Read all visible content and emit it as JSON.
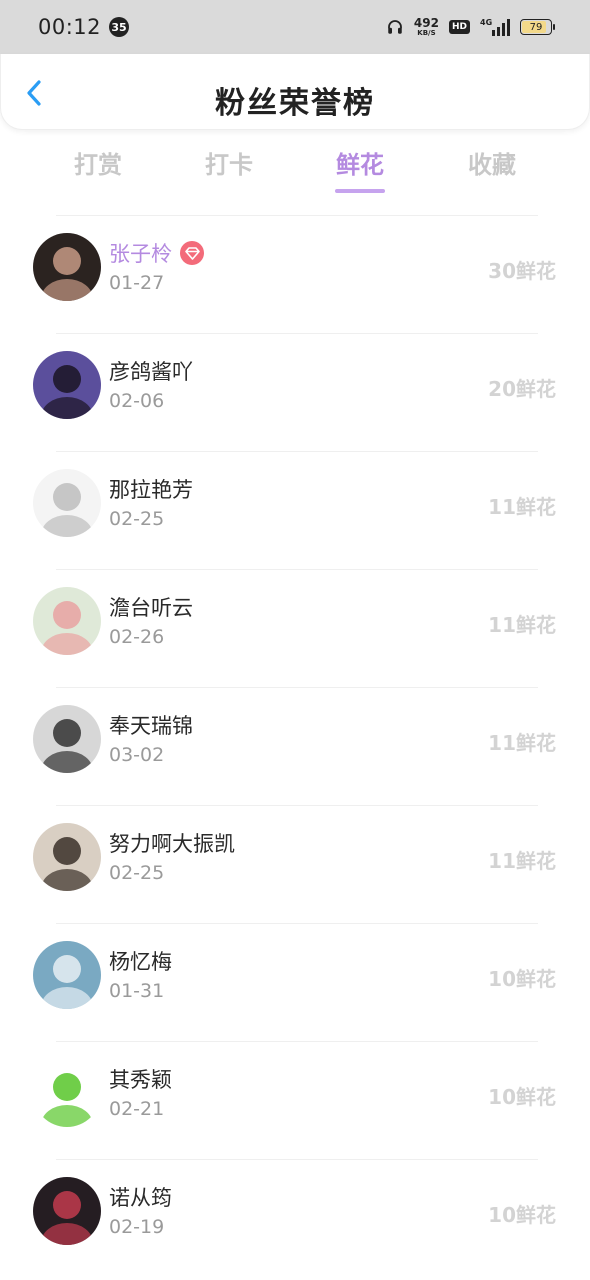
{
  "status_bar": {
    "time": "00:12",
    "notification_count": "35",
    "net_speed_value": "492",
    "net_speed_unit": "KB/S",
    "hd_label": "HD",
    "network_label": "4G",
    "battery_level": "79"
  },
  "header": {
    "title": "粉丝荣誉榜",
    "back_icon": "chevron-left-icon"
  },
  "tabs": [
    {
      "label": "打赏",
      "active": false
    },
    {
      "label": "打卡",
      "active": false
    },
    {
      "label": "鲜花",
      "active": true
    },
    {
      "label": "收藏",
      "active": false
    }
  ],
  "colors": {
    "accent": "#b48ae0",
    "badge": "#f36b7a",
    "muted_text": "#9a9a9a",
    "flower_count": "#d3d3d3"
  },
  "fans": [
    {
      "name": "张子柃",
      "date": "01-27",
      "flowers": "30鲜花",
      "top": true,
      "avatar": {
        "bg": "#2b2320",
        "fg": "#c79a86"
      }
    },
    {
      "name": "彦鸽酱吖",
      "date": "02-06",
      "flowers": "20鲜花",
      "top": false,
      "avatar": {
        "bg": "#5b4f9c",
        "fg": "#1b1424"
      }
    },
    {
      "name": "那拉艳芳",
      "date": "02-25",
      "flowers": "11鲜花",
      "top": false,
      "avatar": {
        "bg": "#f4f4f4",
        "fg": "#bdbdbd"
      }
    },
    {
      "name": "澹台听云",
      "date": "02-26",
      "flowers": "11鲜花",
      "top": false,
      "avatar": {
        "bg": "#dfe9d8",
        "fg": "#e9a2a2"
      }
    },
    {
      "name": "奉天瑞锦",
      "date": "03-02",
      "flowers": "11鲜花",
      "top": false,
      "avatar": {
        "bg": "#d7d7d7",
        "fg": "#333333"
      }
    },
    {
      "name": "努力啊大振凯",
      "date": "02-25",
      "flowers": "11鲜花",
      "top": false,
      "avatar": {
        "bg": "#d9cfc3",
        "fg": "#3a3029"
      }
    },
    {
      "name": "杨忆梅",
      "date": "01-31",
      "flowers": "10鲜花",
      "top": false,
      "avatar": {
        "bg": "#7aa9c2",
        "fg": "#e6eef3"
      }
    },
    {
      "name": "其秀颖",
      "date": "02-21",
      "flowers": "10鲜花",
      "top": false,
      "avatar": {
        "bg": "#ffffff",
        "fg": "#57c629"
      }
    },
    {
      "name": "诺从筠",
      "date": "02-19",
      "flowers": "10鲜花",
      "top": false,
      "avatar": {
        "bg": "#251d22",
        "fg": "#c23b4e"
      }
    }
  ]
}
